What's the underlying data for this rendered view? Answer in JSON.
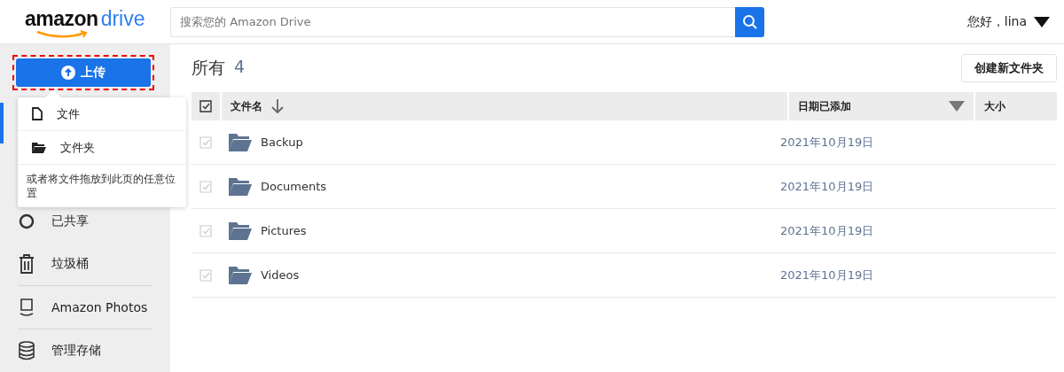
{
  "logo": {
    "word": "amazon",
    "product": "drive"
  },
  "search": {
    "placeholder": "搜索您的 Amazon Drive"
  },
  "user": {
    "greeting": "您好，lina"
  },
  "upload_button": {
    "label": "上传"
  },
  "upload_menu": {
    "items": [
      {
        "kind": "file",
        "label": "文件"
      },
      {
        "kind": "folder",
        "label": "文件夹"
      }
    ],
    "hint": "或者将文件拖放到此页的任意位置"
  },
  "sidebar": {
    "items": [
      {
        "kind": "shared",
        "label": "已共享"
      },
      {
        "kind": "trash",
        "label": "垃圾桶"
      },
      {
        "kind": "photos",
        "label": "Amazon Photos"
      },
      {
        "kind": "storage",
        "label": "管理存储"
      }
    ]
  },
  "main": {
    "title": "所有",
    "count": "4",
    "new_folder_button": "创建新文件夹"
  },
  "table": {
    "select_all": {
      "checked": false
    },
    "columns": [
      "文件名",
      "日期已添加",
      "大小"
    ],
    "rows": [
      {
        "name": "Backup",
        "date": "2021年10月19日",
        "checked": false
      },
      {
        "name": "Documents",
        "date": "2021年10月19日",
        "checked": false
      },
      {
        "name": "Pictures",
        "date": "2021年10月19日",
        "checked": false
      },
      {
        "name": "Videos",
        "date": "2021年10月19日",
        "checked": false
      }
    ]
  }
}
